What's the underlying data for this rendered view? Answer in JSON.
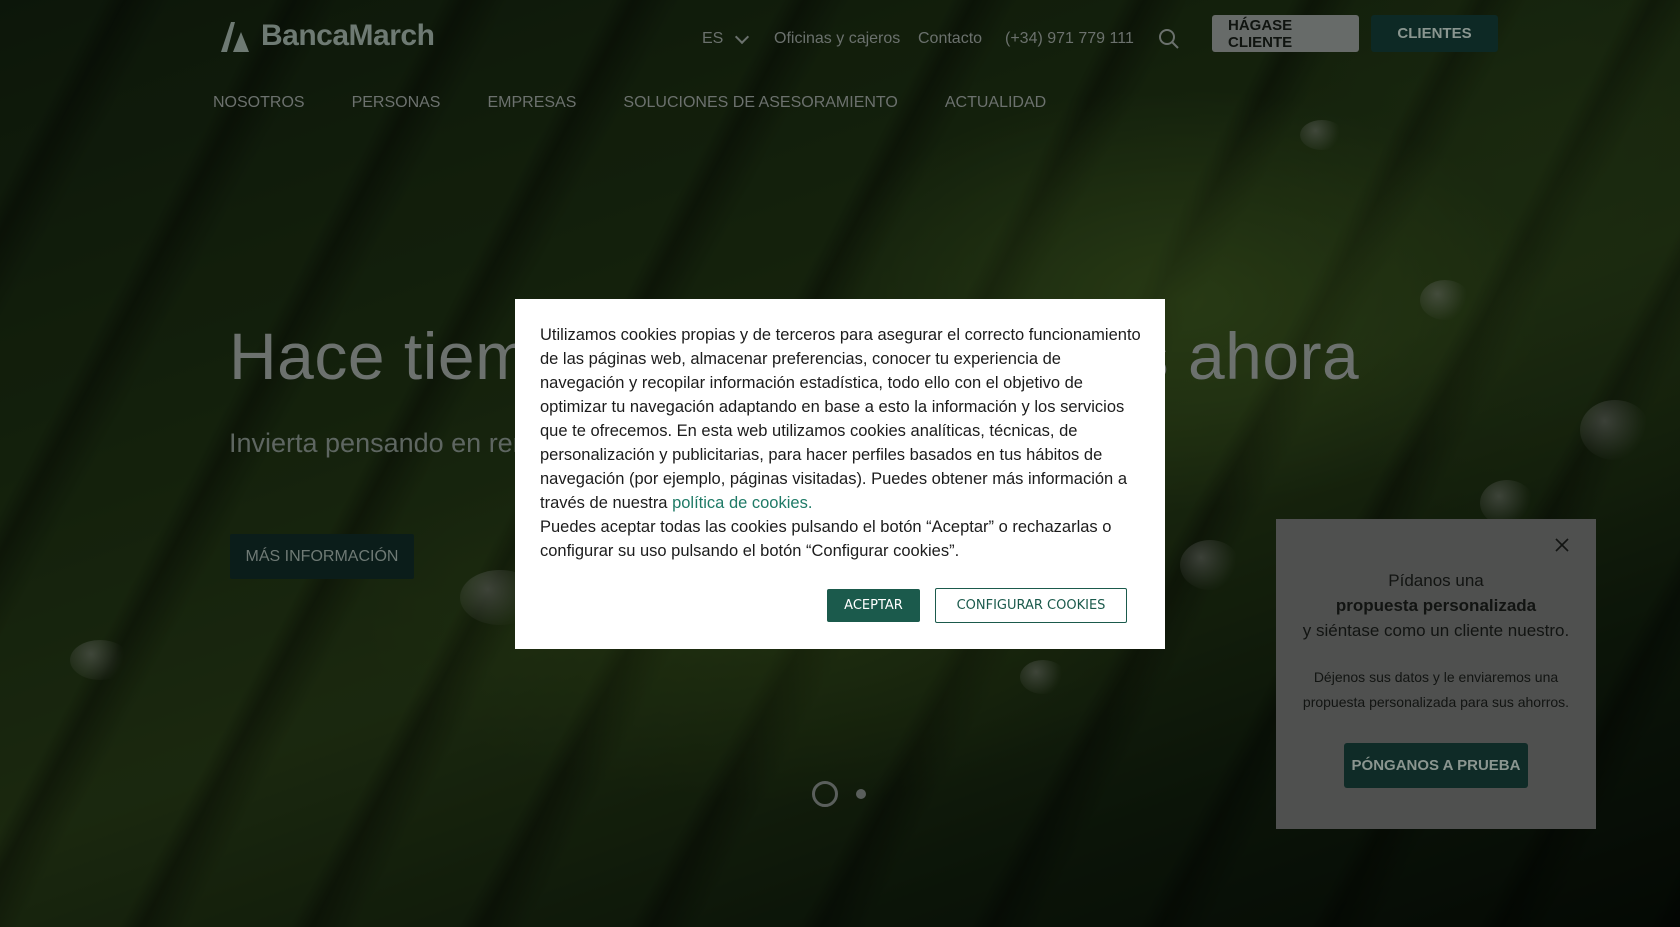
{
  "header": {
    "logo_text": "BancaMarch",
    "language": "ES",
    "links": [
      "Oficinas y cajeros",
      "Contacto",
      "(+34) 971 779 111"
    ],
    "btn_hagase": "HÁGASE CLIENTE",
    "btn_clientes": "CLIENTES"
  },
  "nav": [
    "NOSOTROS",
    "PERSONAS",
    "EMPRESAS",
    "SOLUCIONES DE ASESORAMIENTO",
    "ACTUALIDAD"
  ],
  "hero": {
    "title_left": "Hace tiem",
    "title_right": "s ahora",
    "subtitle": "Invierta pensando en ren",
    "button": "MÁS INFORMACIÓN",
    "slides_total": 2,
    "slide_active": 1
  },
  "side_panel": {
    "line1": "Pídanos una",
    "line2": "propuesta personalizada",
    "line3": "y siéntase como un cliente nuestro.",
    "desc": "Déjenos sus datos y le enviaremos una propuesta personalizada para sus ahorros.",
    "button": "PÓNGANOS A PRUEBA"
  },
  "cookie": {
    "text1": "Utilizamos cookies propias y de terceros para asegurar el correcto funcionamiento de las páginas web, almacenar preferencias, conocer tu experiencia de navegación y recopilar información estadística, todo ello con el objetivo de optimizar tu navegación adaptando en base a esto la información y los servicios que te ofrecemos. En esta web utilizamos cookies analíticas, técnicas, de personalización y publicitarias, para hacer perfiles basados en tus hábitos de navegación (por ejemplo, páginas visitadas). Puedes obtener más información a través de nuestra ",
    "link": "política de cookies.",
    "text2": "Puedes aceptar todas las cookies pulsando el botón “Aceptar” o rechazarlas o configurar su uso pulsando el botón “Configurar cookies”.",
    "btn_accept": "ACEPTAR",
    "btn_config": "CONFIGURAR COOKIES"
  },
  "colors": {
    "brand_green": "#1b5a4c",
    "dark_teal": "#0f2b27",
    "link_green": "#1e7a66"
  }
}
